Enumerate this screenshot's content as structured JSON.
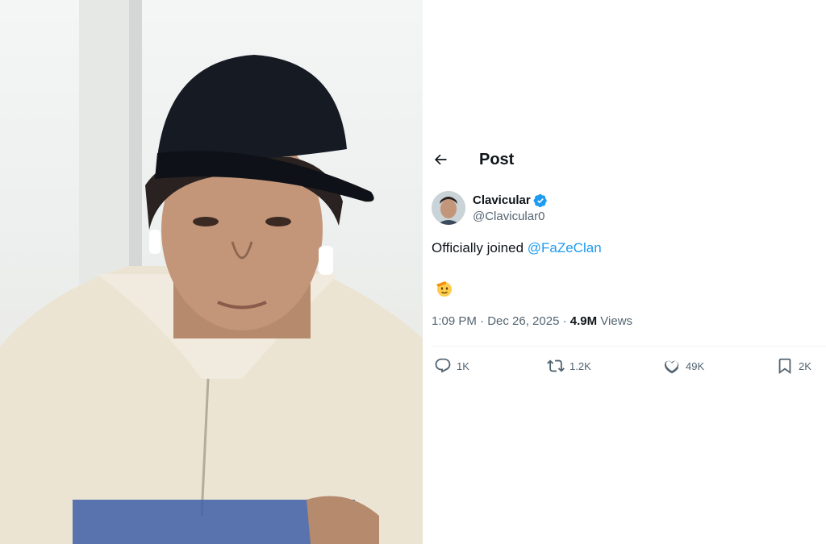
{
  "header": {
    "title": "Post"
  },
  "author": {
    "display_name": "Clavicular",
    "handle": "@Clavicular0",
    "verified": true
  },
  "post": {
    "text_prefix": "Officially joined ",
    "mention": "@FaZeClan",
    "line2": "",
    "timestamp": "1:09 PM · Dec 26, 2025",
    "views_separator": " · ",
    "views_count": "4.9M",
    "views_label": " Views"
  },
  "actions": {
    "replies": "1K",
    "reposts": "1.2K",
    "likes": "49K",
    "bookmarks": "2K"
  },
  "colors": {
    "accent": "#1d9bf0",
    "secondary_text": "#536471",
    "primary_text": "#0f1419"
  },
  "icons": [
    "back-arrow-icon",
    "verified-badge-icon",
    "reply-icon",
    "repost-icon",
    "like-icon",
    "bookmark-icon"
  ]
}
